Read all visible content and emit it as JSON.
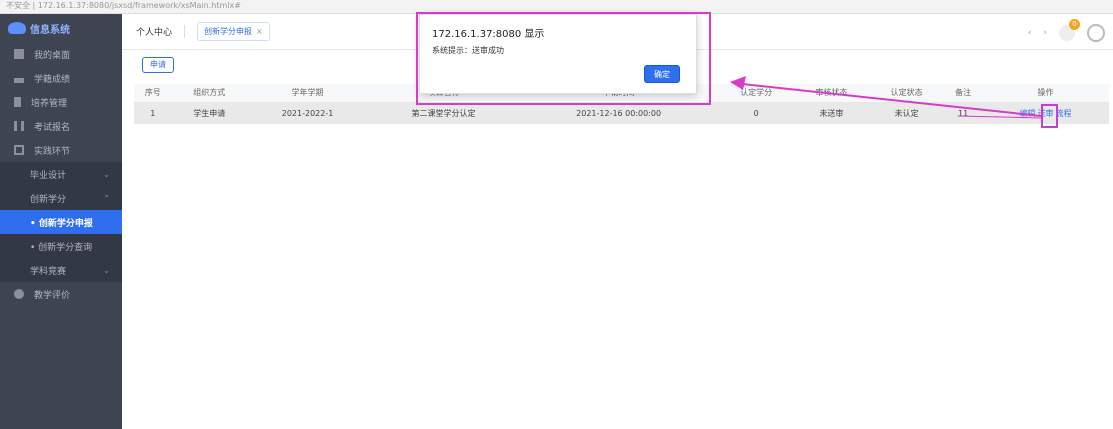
{
  "address_bar": "不安全 | 172.16.1.37:8080/jsxsd/framework/xsMain.htmlx#",
  "sidebar": {
    "logo_text": "信息系统",
    "items": [
      {
        "label": "我的桌面",
        "icon": "desktop-icon"
      },
      {
        "label": "学籍成绩",
        "icon": "graduation-icon"
      },
      {
        "label": "培养管理",
        "icon": "training-icon"
      },
      {
        "label": "考试报名",
        "icon": "exam-icon"
      },
      {
        "label": "实践环节",
        "icon": "practice-icon"
      }
    ],
    "sub_items": [
      {
        "label": "毕业设计",
        "chevron": "⌄"
      },
      {
        "label": "创新学分",
        "chevron": "⌃"
      },
      {
        "label": "• 创新学分申报",
        "chevron": ""
      },
      {
        "label": "• 创新学分查询",
        "chevron": ""
      },
      {
        "label": "学科竞赛",
        "chevron": "⌄"
      }
    ],
    "bottom_item": {
      "label": "教学评价",
      "icon": "user-icon"
    }
  },
  "tabs": {
    "home": "个人中心",
    "active": "创新学分申报",
    "close": "×"
  },
  "header": {
    "nav_prev": "‹",
    "nav_next": "›",
    "badge_count": "0"
  },
  "apply_button": "申请",
  "table": {
    "columns": [
      "序号",
      "组织方式",
      "学年学期",
      "项目名称",
      "申请时间",
      "认定学分",
      "审核状态",
      "认定状态",
      "备注",
      "操作"
    ],
    "rows": [
      [
        "1",
        "学生申请",
        "2021-2022-1",
        "第二课堂学分认定",
        "2021-12-16 00:00:00",
        "0",
        "未送审",
        "未认定",
        "11"
      ]
    ],
    "actions": [
      "编辑",
      "送审",
      "流程"
    ]
  },
  "dialog": {
    "host": "172.16.1.37:8080 显示",
    "message": "系统提示：送审成功",
    "ok": "确定"
  },
  "colors": {
    "accent": "#2f6fed",
    "annotation": "#d63cc8",
    "sidebar": "#3e4452"
  }
}
